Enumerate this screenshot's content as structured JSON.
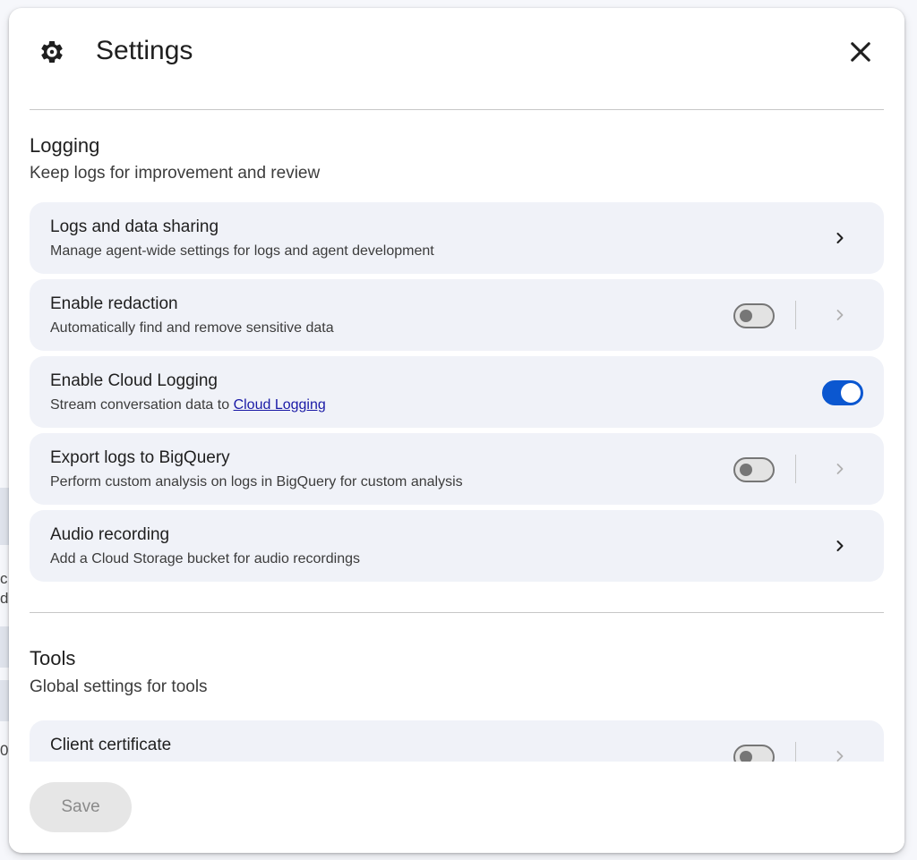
{
  "dialog": {
    "title": "Settings",
    "icon": "gear-icon",
    "close_icon": "close-icon"
  },
  "background": {
    "fragments": [
      "c",
      "d",
      "0"
    ]
  },
  "sections": {
    "logging": {
      "title": "Logging",
      "subtitle": "Keep logs for improvement and review",
      "rows": [
        {
          "label": "Logs and data sharing",
          "description": "Manage agent-wide settings for logs and agent development",
          "control": "chevron"
        },
        {
          "label": "Enable redaction",
          "description": "Automatically find and remove sensitive data",
          "control": "toggle",
          "enabled": false
        },
        {
          "label": "Enable Cloud Logging",
          "description_prefix": "Stream conversation data to ",
          "description_link": "Cloud Logging",
          "control": "toggle",
          "enabled": true
        },
        {
          "label": "Export logs to BigQuery",
          "description": "Perform custom analysis on logs in BigQuery for custom analysis",
          "control": "toggle",
          "enabled": false
        },
        {
          "label": "Audio recording",
          "description": "Add a Cloud Storage bucket for audio recordings",
          "control": "chevron"
        }
      ]
    },
    "tools": {
      "title": "Tools",
      "subtitle": "Global settings for tools",
      "rows": [
        {
          "label": "Client certificate",
          "control": "toggle",
          "enabled": false
        }
      ]
    }
  },
  "footer": {
    "save_label": "Save"
  },
  "colors": {
    "accent": "#0b57d0",
    "row_background": "#f0f2f8",
    "divider": "#c7c7c7",
    "toggle_off": "#767676",
    "disabled_button": "#e6e6e6"
  }
}
